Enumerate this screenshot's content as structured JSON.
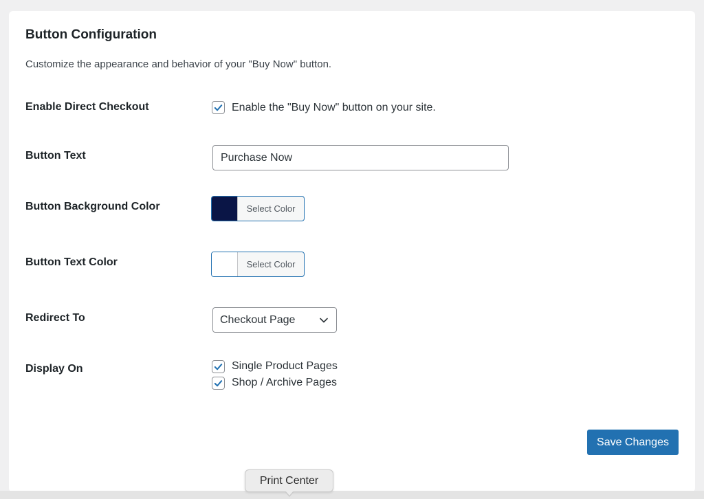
{
  "section": {
    "title": "Button Configuration",
    "description": "Customize the appearance and behavior of your \"Buy Now\" button."
  },
  "fields": {
    "direct_checkout": {
      "label": "Enable Direct Checkout",
      "checkbox_label": "Enable the \"Buy Now\" button on your site.",
      "checked": true
    },
    "button_text": {
      "label": "Button Text",
      "value": "Purchase Now"
    },
    "bg_color": {
      "label": "Button Background Color",
      "button_label": "Select Color",
      "color": "#0a1546"
    },
    "text_color": {
      "label": "Button Text Color",
      "button_label": "Select Color",
      "color": "#ffffff"
    },
    "redirect": {
      "label": "Redirect To",
      "selected": "Checkout Page"
    },
    "display_on": {
      "label": "Display On",
      "options": [
        {
          "label": "Single Product Pages",
          "checked": true
        },
        {
          "label": "Shop / Archive Pages",
          "checked": true
        }
      ]
    }
  },
  "actions": {
    "save_label": "Save Changes"
  },
  "tooltip": {
    "text": "Print Center"
  },
  "colors": {
    "accent": "#2271b1",
    "checkmark": "#2271b1"
  }
}
